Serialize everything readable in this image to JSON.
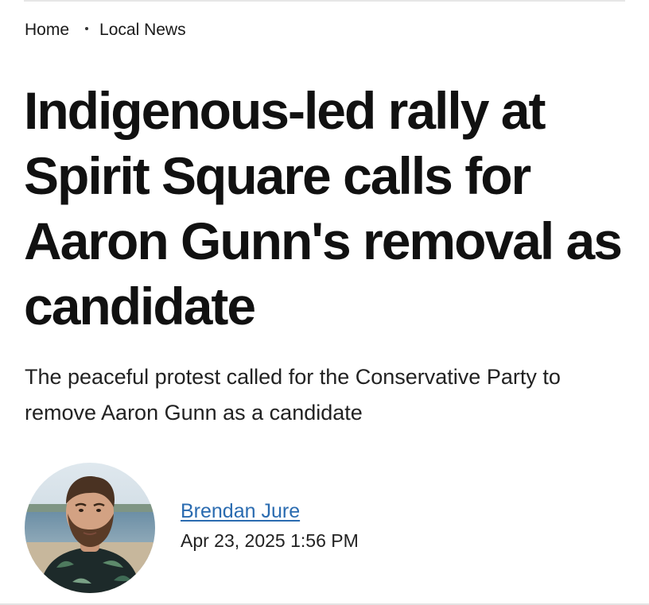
{
  "breadcrumb": {
    "home": "Home",
    "section": "Local News"
  },
  "article": {
    "headline": "Indigenous-led rally at Spirit Square calls for Aaron Gunn's removal as candidate",
    "dek": "The peaceful protest called for the Conservative Party to remove Aaron Gunn as a candidate"
  },
  "byline": {
    "author": "Brendan Jure",
    "timestamp": "Apr 23, 2025 1:56 PM",
    "author_link_color": "#2a6bb0"
  },
  "icons": {
    "avatar": "author-photo"
  }
}
